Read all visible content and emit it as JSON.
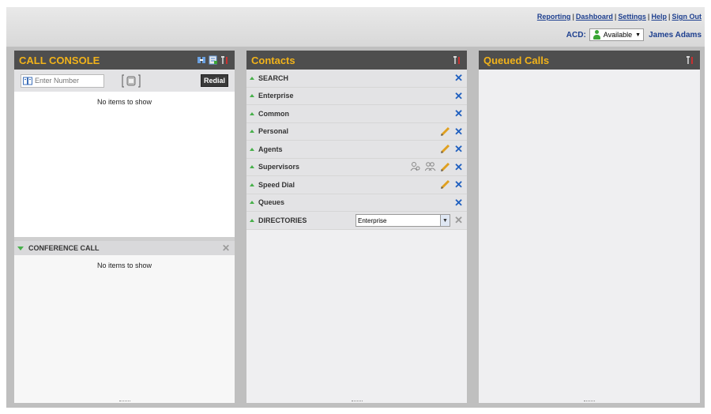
{
  "topbar": {
    "links": [
      "Reporting",
      "Dashboard",
      "Settings",
      "Help",
      "Sign Out"
    ],
    "acd_label": "ACD:",
    "acd_status": "Available",
    "user_name": "James Adams"
  },
  "call_console": {
    "title": "CALL CONSOLE",
    "number_placeholder": "Enter Number",
    "redial_label": "Redial",
    "empty_text": "No items to show",
    "conference_title": "CONFERENCE CALL",
    "conference_empty_text": "No items to show"
  },
  "contacts": {
    "title": "Contacts",
    "groups": [
      {
        "label": "SEARCH"
      },
      {
        "label": "Enterprise"
      },
      {
        "label": "Common"
      },
      {
        "label": "Personal"
      },
      {
        "label": "Agents"
      },
      {
        "label": "Supervisors"
      },
      {
        "label": "Speed Dial"
      },
      {
        "label": "Queues"
      },
      {
        "label": "DIRECTORIES"
      }
    ],
    "directory_selected": "Enterprise"
  },
  "queued_calls": {
    "title": "Queued Calls"
  },
  "colors": {
    "header_bg": "#4e4e4e",
    "header_text": "#f2b31a",
    "accent_blue": "#1f5fbf",
    "status_green": "#3aa635"
  }
}
